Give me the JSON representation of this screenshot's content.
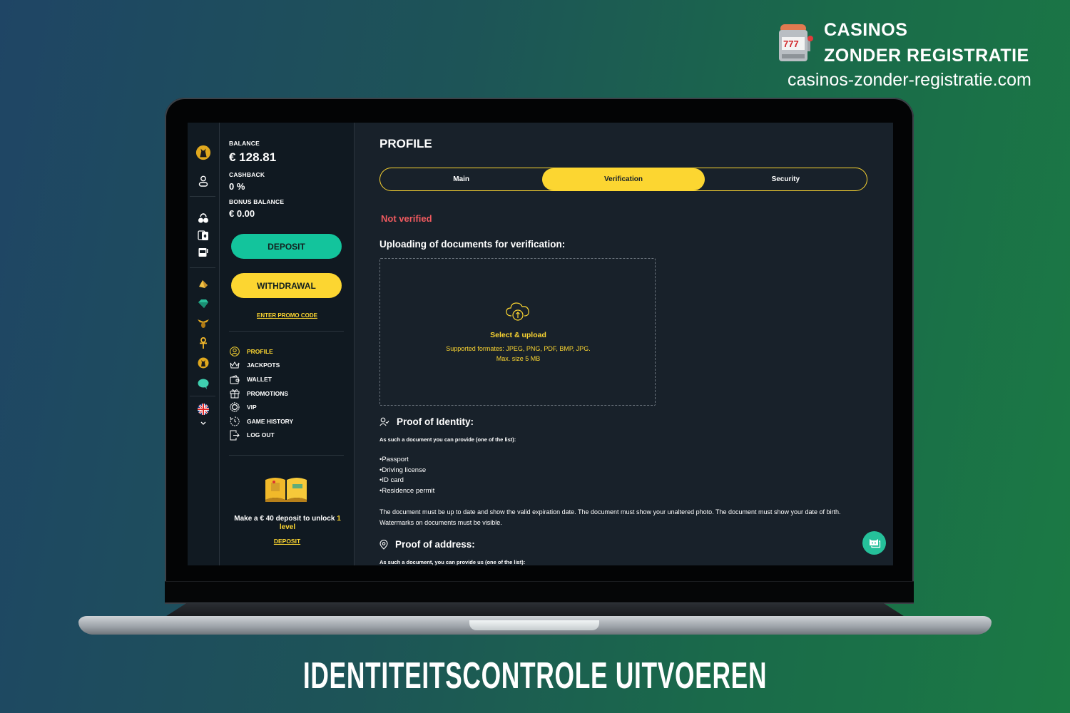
{
  "branding": {
    "line1": "CASINOS",
    "line2": "ZONDER REGISTRATIE",
    "url": "casinos-zonder-registratie.com",
    "logo_icon": "slot-machine-777-icon"
  },
  "caption": "IDENTITEITSCONTROLE UITVOEREN",
  "colors": {
    "accent_yellow": "#fcd631",
    "accent_teal": "#13c49c",
    "error_red": "#f05a5f",
    "panel_bg": "#18212a",
    "sidebar_bg": "#101921"
  },
  "rail": {
    "icons": [
      "cat-avatar-icon",
      "user-icon",
      "cherries-icon",
      "cards-icon",
      "slot-machine-icon",
      "pyramid-icon",
      "gem-icon",
      "winged-scarab-icon",
      "ankh-icon",
      "cat-coin-icon",
      "chat-bubble-icon",
      "uk-flag-icon",
      "chevron-down-icon"
    ]
  },
  "wallet": {
    "balance_label": "BALANCE",
    "balance_value": "€ 128.81",
    "cashback_label": "CASHBACK",
    "cashback_value": "0 %",
    "bonus_label": "BONUS BALANCE",
    "bonus_value": "€ 0.00",
    "deposit_label": "DEPOSIT",
    "withdraw_label": "WITHDRAWAL",
    "promo_label": "ENTER PROMO CODE"
  },
  "menu": [
    {
      "label": "PROFILE",
      "icon": "profile-icon",
      "active": true
    },
    {
      "label": "JACKPOTS",
      "icon": "crown-icon"
    },
    {
      "label": "WALLET",
      "icon": "wallet-icon"
    },
    {
      "label": "PROMOTIONS",
      "icon": "gift-icon"
    },
    {
      "label": "VIP",
      "icon": "vip-badge-icon"
    },
    {
      "label": "GAME HISTORY",
      "icon": "history-clock-icon"
    },
    {
      "label": "LOG OUT",
      "icon": "logout-icon"
    }
  ],
  "vip_promo": {
    "text_prefix": "Make a € 40 deposit to unlock ",
    "level_num": "1",
    "level_word": "level",
    "link": "DEPOSIT"
  },
  "profile": {
    "title": "PROFILE",
    "tabs": [
      {
        "label": "Main"
      },
      {
        "label": "Verification",
        "active": true
      },
      {
        "label": "Security"
      }
    ],
    "status": "Not verified",
    "upload_title": "Uploading of documents for verification:",
    "dropzone_title": "Select & upload",
    "dropzone_sub": "Supported formates: JPEG, PNG, PDF, BMP, JPG. Max. size 5 MB",
    "identity": {
      "heading": "Proof of Identity:",
      "intro": "As such a document you can provide (one of the list):",
      "items": [
        "Passport",
        "Driving license",
        "ID card",
        "Residence permit"
      ],
      "note": "The document must be up to date and show the valid expiration date. The document must show your unaltered photo. The document must show your date of birth. Watermarks on documents must be visible."
    },
    "address": {
      "heading": "Proof of address:",
      "intro": "As such a document, you can provide us (one of the list):"
    }
  }
}
